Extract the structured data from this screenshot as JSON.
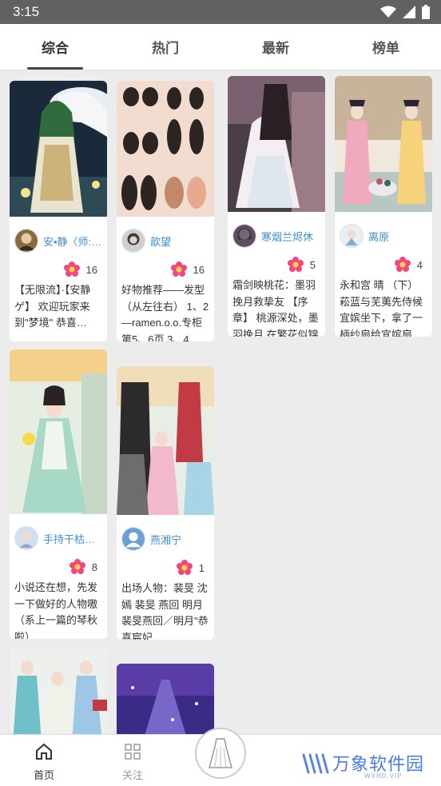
{
  "status": {
    "time": "3:15"
  },
  "tabs": [
    {
      "label": "综合",
      "active": true
    },
    {
      "label": "热门",
      "active": false
    },
    {
      "label": "最新",
      "active": false
    },
    {
      "label": "榜单",
      "active": false
    }
  ],
  "cards": [
    {
      "username": "安•静〈师:…",
      "likes": "16",
      "desc": "【无限流】·【安静ゲ】 欢迎玩家来到\"梦境\" 恭喜…"
    },
    {
      "username": "歆望",
      "likes": "16",
      "desc": "好物推荐——发型（从左往右） 1、2—ramen.o.o.专柜第5、6页 3、4…"
    },
    {
      "username": "寒烟兰烬休",
      "likes": "5",
      "desc": "霜剑映桃花：墨羽挽月救挚友 【序章】 桃源深处，墨羽挽月 在繁花似锦的江南小…"
    },
    {
      "username": "离原",
      "likes": "4",
      "desc": "永和宫 晴 （下）菘蓝与芜荑先侍候宜嫔坐下，拿了一柄纱扇给宜嫔扇风。 菘蓝道：…"
    },
    {
      "username": "手持干枯玫瑰",
      "likes": "8",
      "desc": "小说还在想，先发一下做好的人物嗷（系上一篇的琴秋啦）"
    },
    {
      "username": "燕湘宁",
      "likes": "1",
      "desc": "出场人物：裴旻 沈嫣 裴旻 燕回 明月 裴旻燕回／明月\"恭喜宸妃…"
    }
  ],
  "nav": {
    "home": "首页",
    "follow": "关注"
  },
  "watermark": {
    "brand": "万象软件园",
    "site": "WXHD.VIP"
  },
  "colors": {
    "username": "#3d8fd1",
    "statusbar": "#616161"
  },
  "icons": {
    "likes": "flower-icon",
    "home": "home-icon",
    "follow": "grid-icon",
    "center": "dress-icon"
  }
}
